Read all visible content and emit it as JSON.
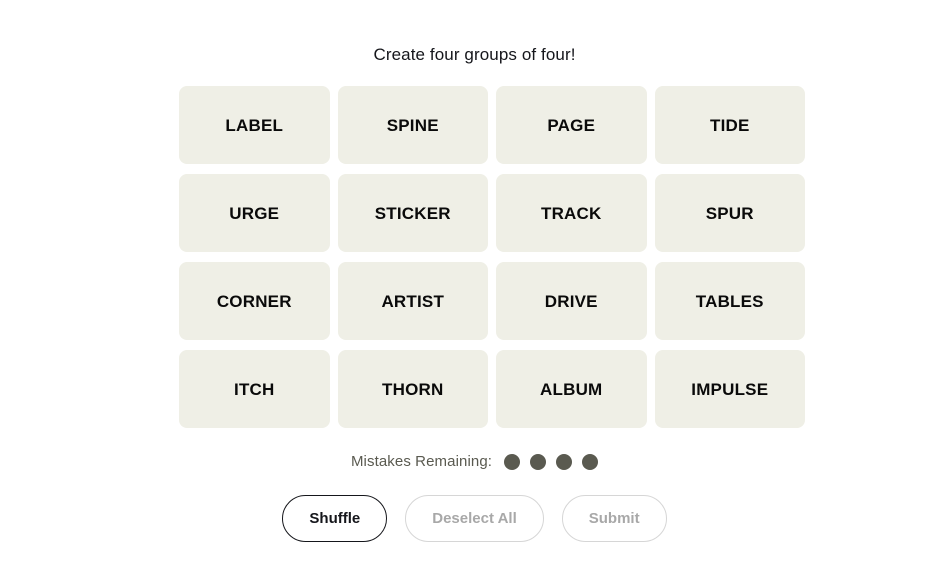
{
  "game": {
    "title": "Create four groups of four!",
    "tiles": [
      {
        "label": "LABEL"
      },
      {
        "label": "SPINE"
      },
      {
        "label": "PAGE"
      },
      {
        "label": "TIDE"
      },
      {
        "label": "URGE"
      },
      {
        "label": "STICKER"
      },
      {
        "label": "TRACK"
      },
      {
        "label": "SPUR"
      },
      {
        "label": "CORNER"
      },
      {
        "label": "ARTIST"
      },
      {
        "label": "DRIVE"
      },
      {
        "label": "TABLES"
      },
      {
        "label": "ITCH"
      },
      {
        "label": "THORN"
      },
      {
        "label": "ALBUM"
      },
      {
        "label": "IMPULSE"
      }
    ],
    "mistakes": {
      "label": "Mistakes Remaining:",
      "remaining": 4,
      "dot_color": "#5a5a50"
    },
    "buttons": {
      "shuffle": {
        "label": "Shuffle",
        "state": "enabled"
      },
      "deselect_all": {
        "label": "Deselect All",
        "state": "disabled"
      },
      "submit": {
        "label": "Submit",
        "state": "disabled"
      }
    },
    "colors": {
      "page_background": "#ffffff",
      "tile_background": "#efefe6",
      "tile_text": "#0a0a0a",
      "title_text": "#15161b",
      "muted_text": "#a8a8a8",
      "muted_border": "#d6d6d6",
      "strong_border": "#15161b"
    }
  }
}
